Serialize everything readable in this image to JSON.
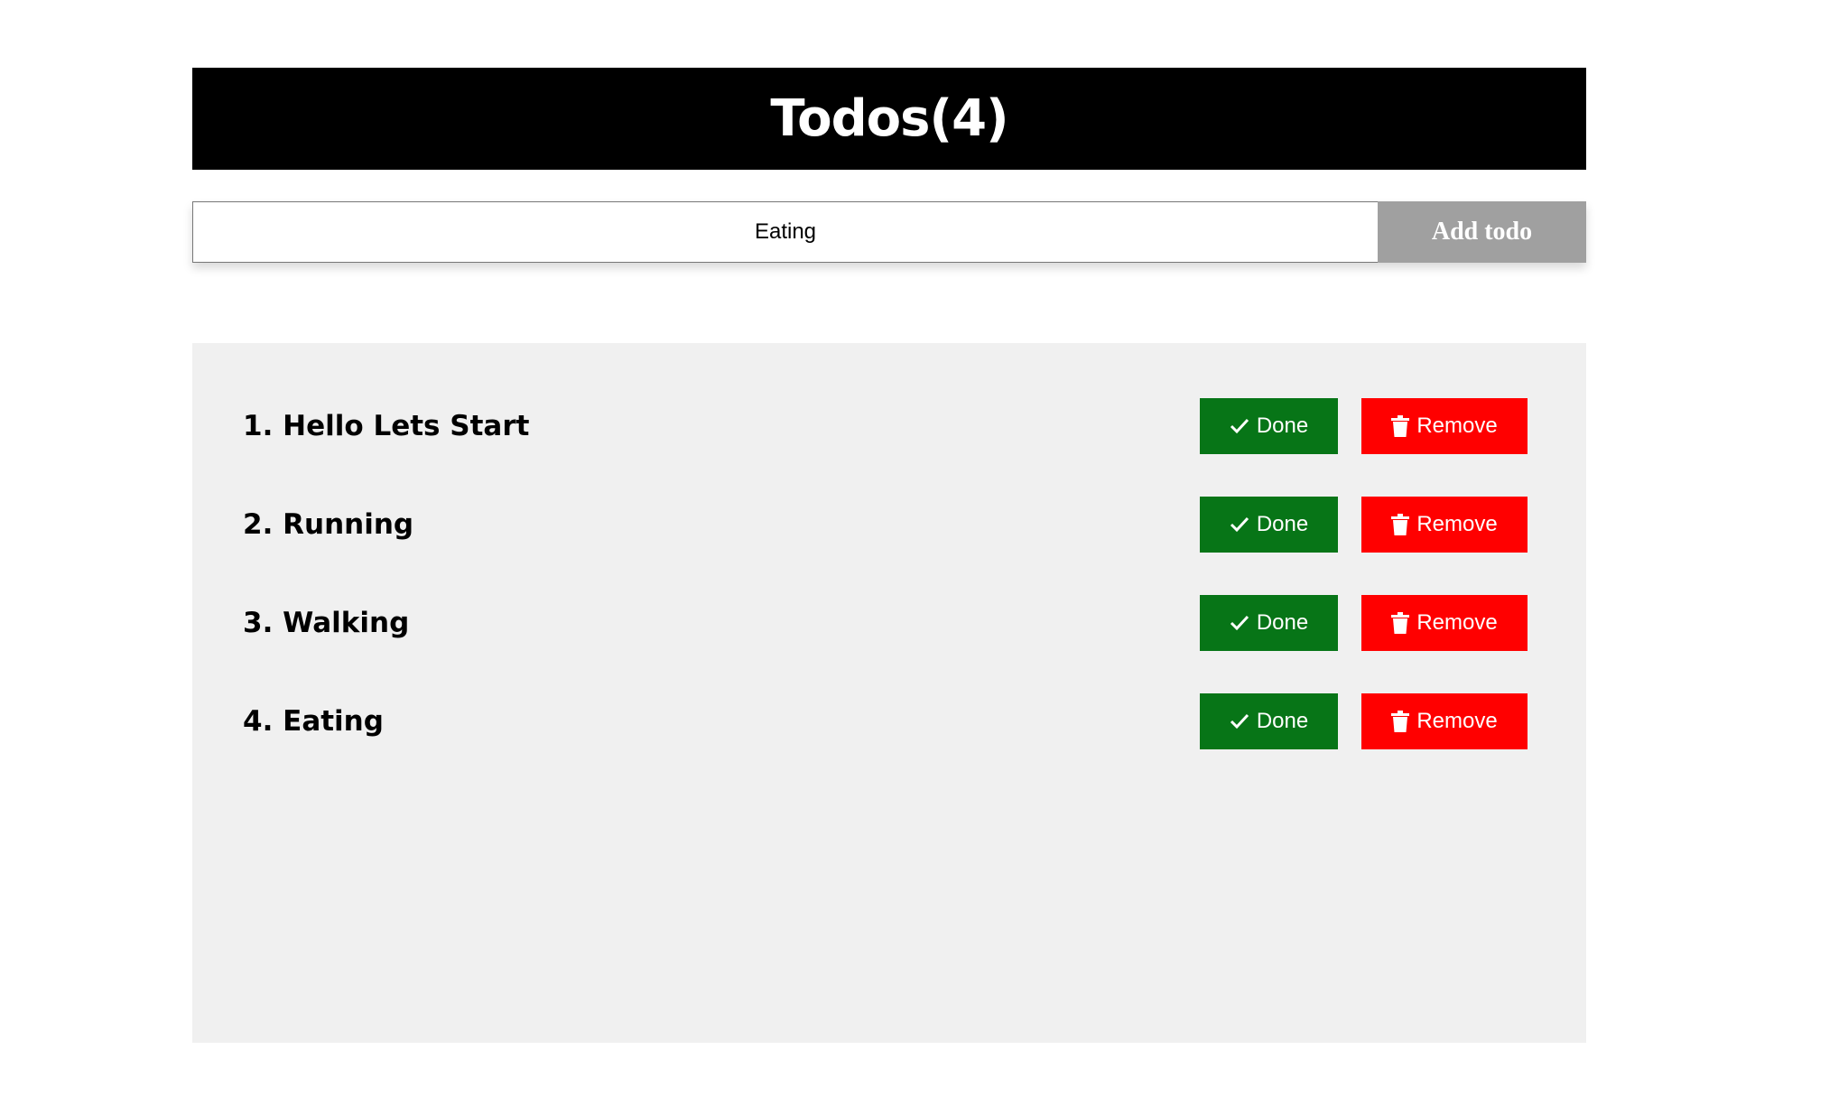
{
  "header": {
    "title": "Todos(4)"
  },
  "form": {
    "input_value": "Eating",
    "add_label": "Add todo"
  },
  "todos": [
    {
      "label": "1. Hello Lets Start",
      "done_label": "Done",
      "remove_label": "Remove"
    },
    {
      "label": "2. Running",
      "done_label": "Done",
      "remove_label": "Remove"
    },
    {
      "label": "3. Walking",
      "done_label": "Done",
      "remove_label": "Remove"
    },
    {
      "label": "4. Eating",
      "done_label": "Done",
      "remove_label": "Remove"
    }
  ],
  "colors": {
    "done": "#077517",
    "remove": "#ff0000",
    "header": "#000000",
    "add_button": "#a0a0a0"
  },
  "icons": {
    "done": "check-icon",
    "remove": "trash-icon"
  }
}
